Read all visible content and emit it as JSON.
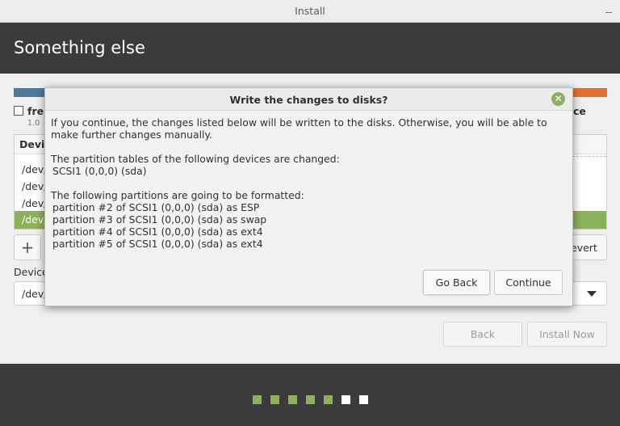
{
  "window": {
    "title": "Install"
  },
  "header": {
    "title": "Something else"
  },
  "background": {
    "free_label": "fre",
    "size_label": "1.0",
    "right_label": "ce",
    "table_header": "Devic",
    "rows": [
      "/dev/",
      "/dev/",
      "/dev/",
      "/dev/"
    ],
    "add_label": "+",
    "revert_label": "evert",
    "device_label": "Device",
    "device_value": "/dev/"
  },
  "nav": {
    "back_label": "Back",
    "install_label": "Install Now"
  },
  "progress": {
    "done_steps": 5,
    "total_steps": 7
  },
  "dialog": {
    "title": "Write the changes to disks?",
    "intro": "If you continue, the changes listed below will be written to the disks. Otherwise, you will be able to make further changes manually.",
    "tables_heading": "The partition tables of the following devices are changed:",
    "tables": [
      "SCSI1 (0,0,0) (sda)"
    ],
    "format_heading": "The following partitions are going to be formatted:",
    "format_items": [
      "partition #2 of SCSI1 (0,0,0) (sda) as ESP",
      "partition #3 of SCSI1 (0,0,0) (sda) as swap",
      "partition #4 of SCSI1 (0,0,0) (sda) as ext4",
      "partition #5 of SCSI1 (0,0,0) (sda) as ext4"
    ],
    "go_back_label": "Go Back",
    "continue_label": "Continue"
  },
  "colors": {
    "accent": "#8cb15c",
    "header_bg": "#3b3b3b"
  }
}
